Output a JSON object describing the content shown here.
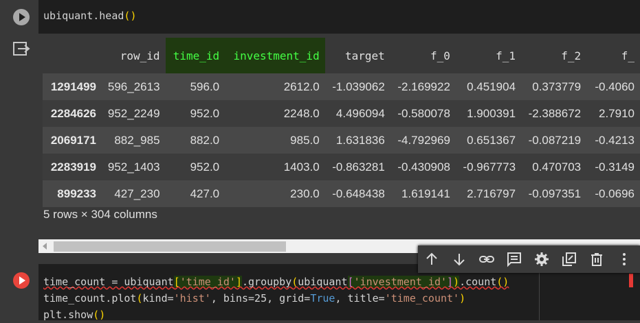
{
  "cell1": {
    "code_obj": "ubiquant",
    "code_dot": ".",
    "code_method": "head",
    "code_open": "(",
    "code_close": ")"
  },
  "dataframe": {
    "columns": [
      "row_id",
      "time_id",
      "investment_id",
      "target",
      "f_0",
      "f_1",
      "f_2",
      "f_"
    ],
    "rows": [
      {
        "index": "1291499",
        "cells": [
          "596_2613",
          "596.0",
          "2612.0",
          "-1.039062",
          "-2.169922",
          "0.451904",
          "0.373779",
          "-0.4060"
        ]
      },
      {
        "index": "2284626",
        "cells": [
          "952_2249",
          "952.0",
          "2248.0",
          "4.496094",
          "-0.580078",
          "1.900391",
          "-2.388672",
          "2.7910"
        ]
      },
      {
        "index": "2069171",
        "cells": [
          "882_985",
          "882.0",
          "985.0",
          "1.631836",
          "-4.792969",
          "0.651367",
          "-0.087219",
          "-0.4213"
        ]
      },
      {
        "index": "2283919",
        "cells": [
          "952_1403",
          "952.0",
          "1403.0",
          "-0.863281",
          "-0.430908",
          "-0.967773",
          "0.470703",
          "-0.3149"
        ]
      },
      {
        "index": "899233",
        "cells": [
          "427_230",
          "427.0",
          "230.0",
          "-0.648438",
          "1.619141",
          "2.716797",
          "-0.097351",
          "-0.0696"
        ]
      }
    ],
    "summary": "5 rows × 304 columns"
  },
  "cell2": {
    "line1": {
      "a": "time_count = ubiquant",
      "b": "[",
      "c": "'time_id'",
      "d": "]",
      "e": ".groupby",
      "f": "(",
      "g": "ubiquant",
      "h": "[",
      "i": "'investment_id'",
      "j": "]",
      "k": ")",
      "l": ".count",
      "m": "()"
    },
    "line2": {
      "a": "time_count.plot",
      "b": "(",
      "c": "kind=",
      "d": "'hist'",
      "e": ", bins=25, grid=",
      "f": "True",
      "g": ", title=",
      "h": "'time_count'",
      "i": ")"
    },
    "line3": {
      "a": "plt.show",
      "b": "()"
    }
  },
  "toolbar": {
    "icons": [
      "arrow-up-icon",
      "arrow-down-icon",
      "link-icon",
      "comment-icon",
      "gear-icon",
      "mirror-cell-icon",
      "trash-icon",
      "more-vert-icon"
    ]
  },
  "colors": {
    "highlight_text": "#44ff44",
    "highlight_bg": "#1f3a10",
    "run_error": "#e8453c"
  }
}
